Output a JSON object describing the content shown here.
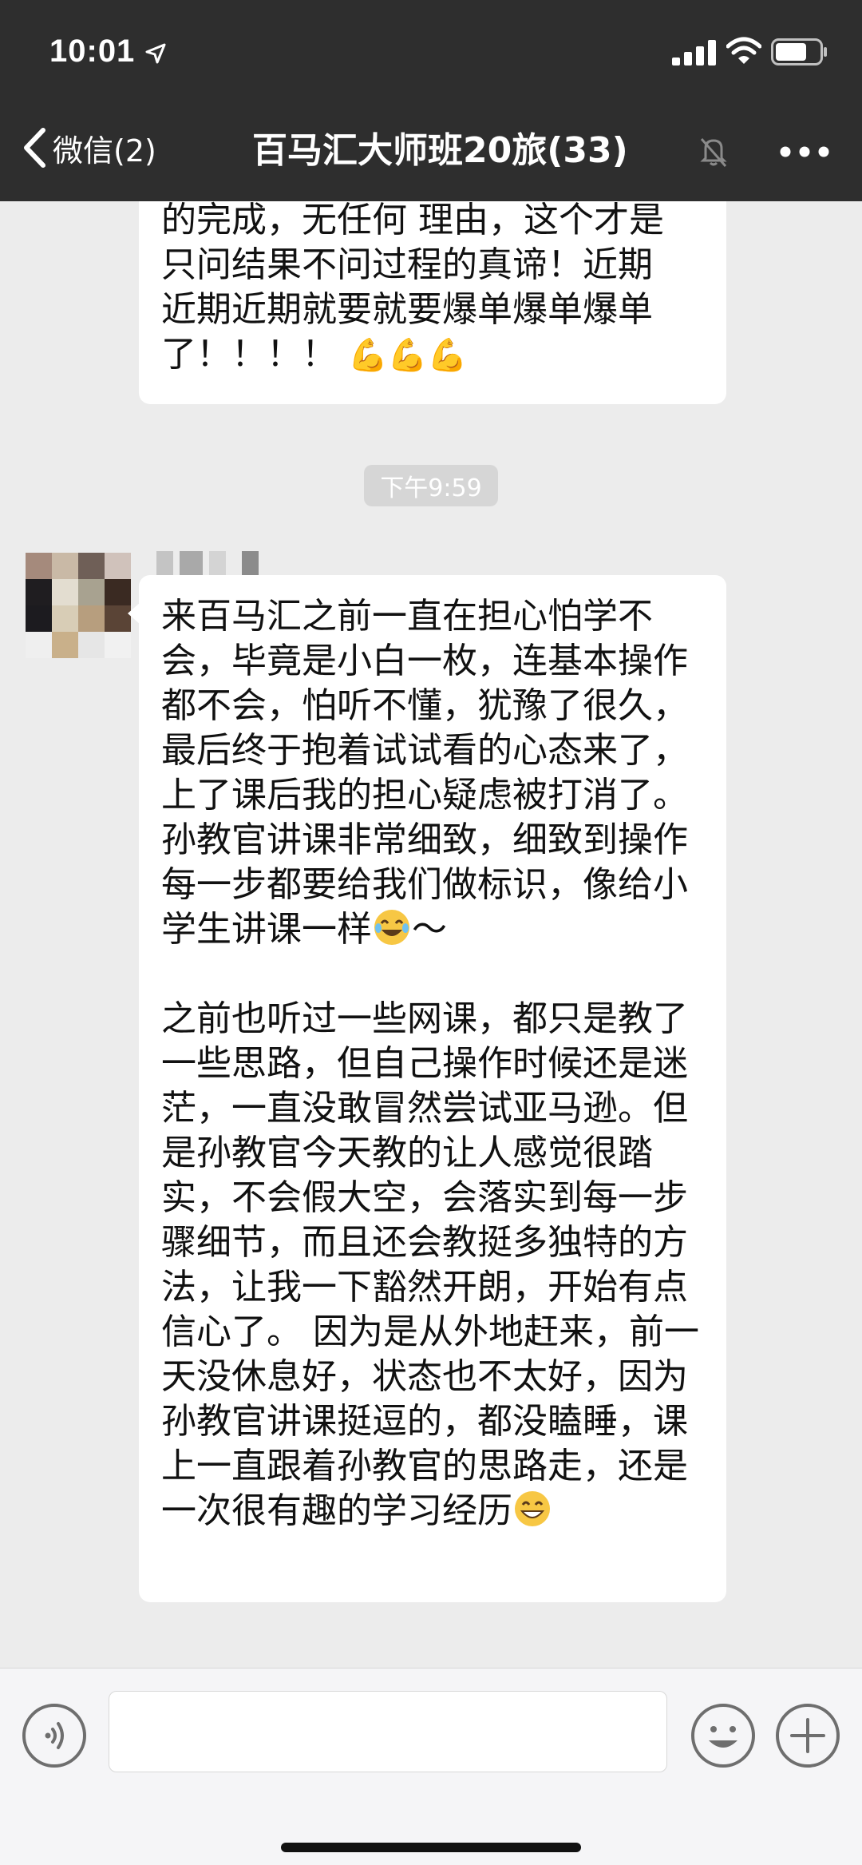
{
  "status_bar": {
    "time": "10:01"
  },
  "nav": {
    "back_label": "微信(2)",
    "title": "百马汇大师班20旅(33)"
  },
  "messages": {
    "first_bubble_lines": [
      "的完成，无任何 理由，这个才是",
      "只问结果不问过程的真谛！近期",
      "近期近期就要就要爆单爆单爆单",
      "了！！！！"
    ],
    "first_bubble_emojis": "💪💪💪",
    "timestamp": "下午9:59",
    "second_bubble": {
      "para1": "来百马汇之前一直在担心怕学不会，毕竟是小白一枚，连基本操作都不会，怕听不懂，犹豫了很久，最后终于抱着试试看的心态来了，上了课后我的担心疑虑被打消了。孙教官讲课非常细致，细致到操作每一步都要给我们做标识，像给小学生讲课一样",
      "para1_tail": "～",
      "para2": "之前也听过一些网课，都只是教了一些思路，但自己操作时候还是迷茫，一直没敢冒然尝试亚马逊。但是孙教官今天教的让人感觉很踏实，不会假大空，会落实到每一步骤细节，而且还会教挺多独特的方法，让我一下豁然开朗，开始有点信心了。 因为是从外地赶来，前一天没休息好，状态也不太好，因为孙教官讲课挺逗的，都没瞌睡，课上一直跟着孙教官的思路走，还是一次很有趣的学习经历"
    }
  },
  "icons": {
    "back": "chevron-left-icon",
    "mute": "mute-bell-icon",
    "more": "more-dots-icon",
    "voice": "voice-icon",
    "emoji": "emoji-icon",
    "plus": "plus-icon"
  },
  "colors": {
    "header_bg": "#2e2e2e",
    "chat_bg": "#ececec",
    "bubble_bg": "#ffffff",
    "input_bg": "#f5f5f7"
  }
}
